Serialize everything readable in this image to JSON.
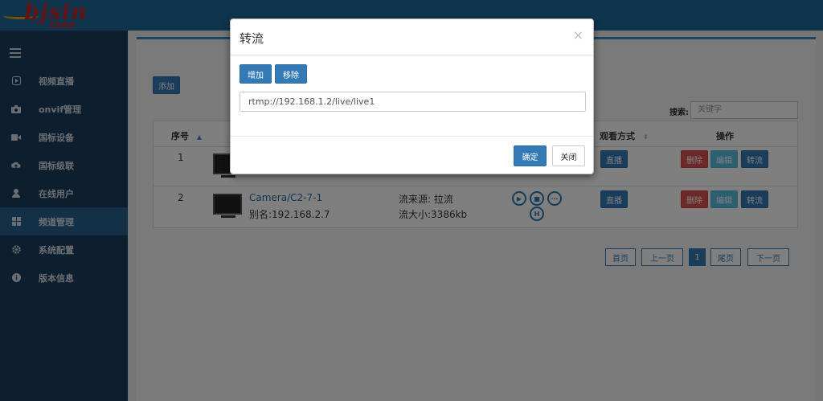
{
  "header": {
    "logo_text": "bjsin",
    "logo_sub": "北极星通"
  },
  "sidebar": {
    "items": [
      {
        "label": "视频直播",
        "icon": "play-icon"
      },
      {
        "label": "onvif管理",
        "icon": "camera-icon"
      },
      {
        "label": "国标设备",
        "icon": "video-icon"
      },
      {
        "label": "国标级联",
        "icon": "cloud-icon"
      },
      {
        "label": "在线用户",
        "icon": "user-icon"
      },
      {
        "label": "频道管理",
        "icon": "grid-icon",
        "active": true
      },
      {
        "label": "系统配置",
        "icon": "gear-icon"
      },
      {
        "label": "版本信息",
        "icon": "info-icon"
      }
    ]
  },
  "main": {
    "add_label": "添加",
    "search_label": "搜索:",
    "search_placeholder": "关键字",
    "columns": {
      "index": "序号",
      "watch": "观看方式",
      "ops": "操作"
    },
    "rows": [
      {
        "index": "1",
        "name": "",
        "alias": "",
        "source": "",
        "size": "",
        "watch": "直播",
        "del": "删除",
        "edit": "编辑",
        "transfer": "转流"
      },
      {
        "index": "2",
        "name": "Camera/C2-7-1",
        "alias": "别名:192.168.2.7",
        "source": "流来源: 拉流",
        "size": "流大小:3386kb",
        "watch": "直播",
        "del": "删除",
        "edit": "编辑",
        "transfer": "转流"
      }
    ],
    "pager": {
      "first": "首页",
      "prev": "上一页",
      "current": "1",
      "last": "尾页",
      "next": "下一页"
    }
  },
  "modal": {
    "title": "转流",
    "close": "×",
    "add_label": "增加",
    "remove_label": "移除",
    "url_value": "rtmp://192.168.1.2/live/live1",
    "confirm_label": "确定",
    "cancel_label": "关闭"
  },
  "colors": {
    "primary": "#337ab7",
    "danger": "#d9534f",
    "info": "#5bc0de",
    "sidebar": "#1b3e5e",
    "header": "#1e6a9c"
  }
}
